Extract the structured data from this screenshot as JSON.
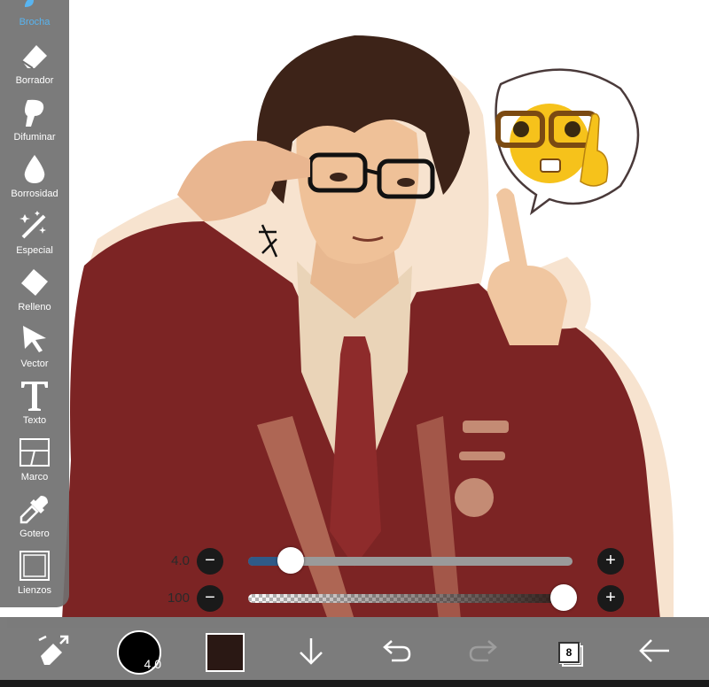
{
  "tools": [
    {
      "id": "brush",
      "label": "Brocha",
      "icon": "brush-icon",
      "active": true
    },
    {
      "id": "eraser",
      "label": "Borrador",
      "icon": "eraser-icon",
      "active": false
    },
    {
      "id": "smudge",
      "label": "Difuminar",
      "icon": "smudge-icon",
      "active": false
    },
    {
      "id": "blur",
      "label": "Borrosidad",
      "icon": "blur-drop-icon",
      "active": false
    },
    {
      "id": "special",
      "label": "Especial",
      "icon": "magic-wand-icon",
      "active": false
    },
    {
      "id": "fill",
      "label": "Relleno",
      "icon": "fill-bucket-icon",
      "active": false
    },
    {
      "id": "vector",
      "label": "Vector",
      "icon": "cursor-arrow-icon",
      "active": false
    },
    {
      "id": "text",
      "label": "Texto",
      "icon": "text-icon",
      "active": false
    },
    {
      "id": "frame",
      "label": "Marco",
      "icon": "frame-icon",
      "active": false
    },
    {
      "id": "dropper",
      "label": "Gotero",
      "icon": "eyedropper-icon",
      "active": false
    },
    {
      "id": "canvas",
      "label": "Lienzos",
      "icon": "canvas-icon",
      "active": false
    }
  ],
  "size_slider": {
    "value_label": "4.0",
    "fraction": 0.13
  },
  "opacity_slider": {
    "value_label": "100",
    "fraction": 1.0
  },
  "bottom_toolbar": {
    "brush_size_label": "4.0",
    "current_color": "#2a1814",
    "layer_count": "8"
  },
  "colors": {
    "accent": "#58b4f0",
    "palette_bg": "#707070",
    "slider_fill": "#2f5a88"
  }
}
